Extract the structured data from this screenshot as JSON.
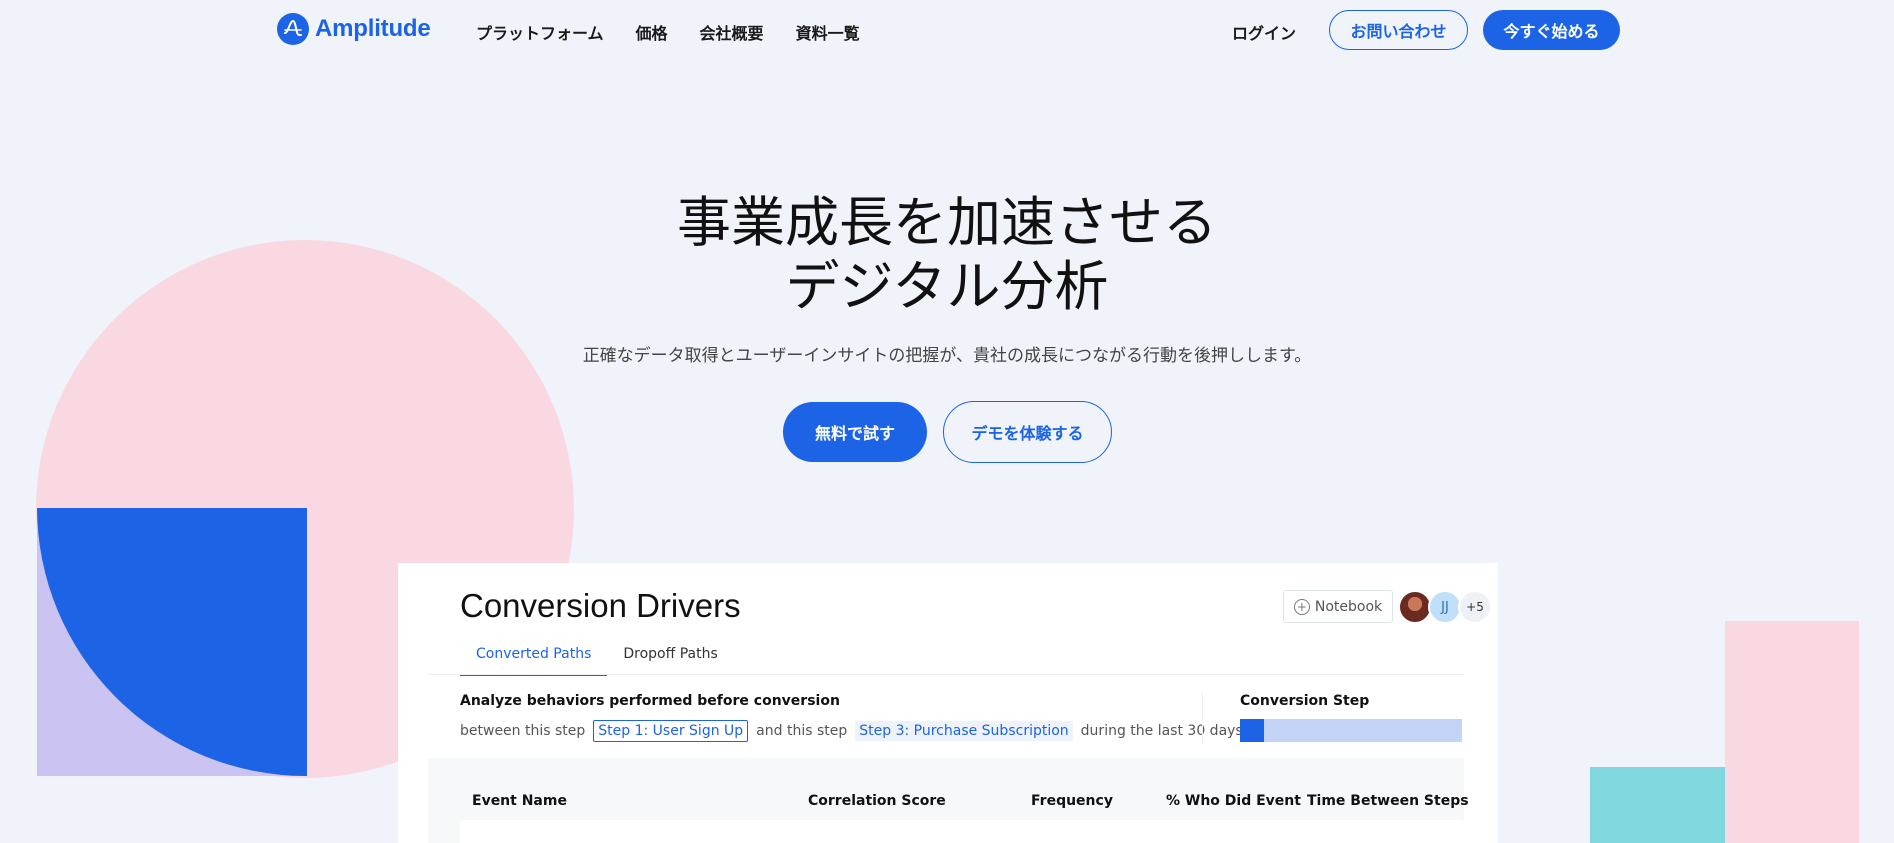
{
  "brand": {
    "name": "Amplitude",
    "accent": "#1c63e6"
  },
  "nav": {
    "links": [
      "プラットフォーム",
      "価格",
      "会社概要",
      "資料一覧"
    ],
    "login": "ログイン",
    "contact": "お問い合わせ",
    "start": "今すぐ始める"
  },
  "hero": {
    "title_line1": "事業成長を加速させる",
    "title_line2": "デジタル分析",
    "subtitle": "正確なデータ取得とユーザーインサイトの把握が、貴社の成長につながる行動を後押しします。",
    "try_button": "無料で試す",
    "demo_button": "デモを体験する"
  },
  "panel": {
    "title": "Conversion Drivers",
    "notebook": "Notebook",
    "avatars": {
      "jj": "JJ",
      "more": "+5"
    },
    "tabs": [
      "Converted Paths",
      "Dropoff Paths"
    ],
    "analyze_heading": "Analyze behaviors performed before conversion",
    "between_text": "between this step",
    "step1": "Step 1: User Sign Up",
    "and_text": "and this step",
    "step3": "Step 3: Purchase Subscription",
    "during_text": "during the last 30 days",
    "conversion_step_label": "Conversion Step",
    "conversion_step_fill": 0.11,
    "table_headers": [
      "Event Name",
      "Correlation Score",
      "Frequency",
      "% Who Did Event",
      "Time Between Steps"
    ]
  },
  "icons": {
    "logo": "amplitude-logo-icon",
    "notebook_add": "plus-circle-icon"
  }
}
